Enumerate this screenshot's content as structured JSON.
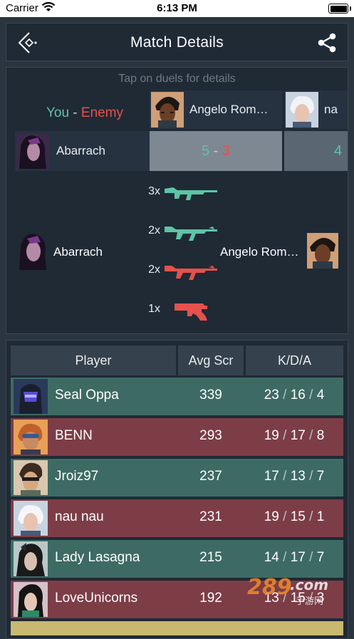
{
  "status": {
    "carrier": "Carrier",
    "time": "6:13 PM"
  },
  "nav": {
    "title": "Match Details"
  },
  "duels": {
    "hint": "Tap on duels for details",
    "you_label": "You",
    "dash": "-",
    "enemy_label": "Enemy",
    "columns": [
      {
        "name": "Angelo Rom…"
      },
      {
        "name": "na"
      }
    ],
    "row": {
      "name": "Abarrach",
      "cells": [
        {
          "you": "5",
          "enemy": "3"
        },
        {
          "you": "4",
          "enemy": ""
        }
      ]
    },
    "detail": {
      "left_name": "Abarrach",
      "right_name": "Angelo Rom…",
      "kills": [
        {
          "count": "3x",
          "weapon": "rifle-icon",
          "side": "you"
        },
        {
          "count": "2x",
          "weapon": "assault-rifle-icon",
          "side": "you"
        },
        {
          "count": "2x",
          "weapon": "assault-rifle-icon",
          "side": "enemy"
        },
        {
          "count": "1x",
          "weapon": "revolver-icon",
          "side": "enemy"
        }
      ]
    }
  },
  "table": {
    "headers": {
      "player": "Player",
      "avg": "Avg Scr",
      "kda": "K/D/A"
    },
    "rows": [
      {
        "name": "Seal Oppa",
        "score": "339",
        "k": "23",
        "d": "16",
        "a": "4",
        "result": "win"
      },
      {
        "name": "BENN",
        "score": "293",
        "k": "19",
        "d": "17",
        "a": "8",
        "result": "loss"
      },
      {
        "name": "Jroiz97",
        "score": "237",
        "k": "17",
        "d": "13",
        "a": "7",
        "result": "win"
      },
      {
        "name": "nau nau",
        "score": "231",
        "k": "19",
        "d": "15",
        "a": "1",
        "result": "loss"
      },
      {
        "name": "Lady Lasagna",
        "score": "215",
        "k": "14",
        "d": "17",
        "a": "7",
        "result": "win"
      },
      {
        "name": "LoveUnicorns",
        "score": "192",
        "k": "13",
        "d": "15",
        "a": "3",
        "result": "loss"
      }
    ],
    "kda_sep": "/"
  },
  "watermark": {
    "text": "289.com",
    "sub": "手游网"
  },
  "colors": {
    "accent_green": "#5ec4a6",
    "accent_red": "#e5514d",
    "win_row": "#3d6b63",
    "loss_row": "#7d3d47"
  }
}
